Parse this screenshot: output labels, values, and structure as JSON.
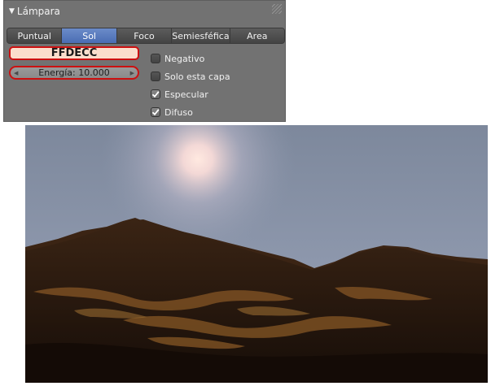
{
  "panel": {
    "title": "Lámpara",
    "icons": {
      "collapse": "triangle-down-icon",
      "grip": "drag-grip-icon"
    },
    "tabs": [
      {
        "label": "Puntual",
        "active": false
      },
      {
        "label": "Sol",
        "active": true
      },
      {
        "label": "Foco",
        "active": false
      },
      {
        "label": "Semiesféfica",
        "active": false
      },
      {
        "label": "Area",
        "active": false
      }
    ],
    "color_value": "FFDECC",
    "energy_label": "Energía: 10.000",
    "checkboxes": [
      {
        "label": "Negativo",
        "checked": false
      },
      {
        "label": "Solo esta capa",
        "checked": false
      },
      {
        "label": "Especular",
        "checked": true
      },
      {
        "label": "Difuso",
        "checked": true
      }
    ]
  },
  "colors": {
    "panel_bg": "#727272",
    "active_tab": "#5a7cc0",
    "lamp_color": "#FFDECC",
    "highlight_border": "#cc1010",
    "sky": "#8892a3",
    "terrain": "#2a1a10"
  }
}
